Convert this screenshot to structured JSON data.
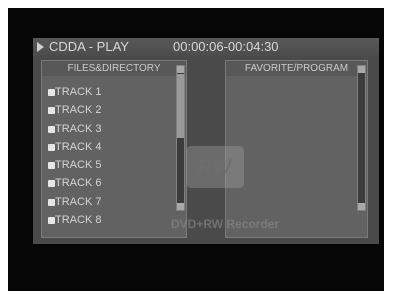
{
  "title_bar": {
    "mode": "CDDA - PLAY",
    "time": "00:00:06-00:04:30"
  },
  "files_panel": {
    "header": "FILES&DIRECTORY",
    "tracks": [
      "TRACK 1",
      "TRACK 2",
      "TRACK 3",
      "TRACK 4",
      "TRACK 5",
      "TRACK 6",
      "TRACK 7",
      "TRACK 8"
    ]
  },
  "favorites_panel": {
    "header": "FAVORITE/PROGRAM"
  },
  "watermark": {
    "logo_text": "RW",
    "label": "DVD+RW Recorder"
  }
}
